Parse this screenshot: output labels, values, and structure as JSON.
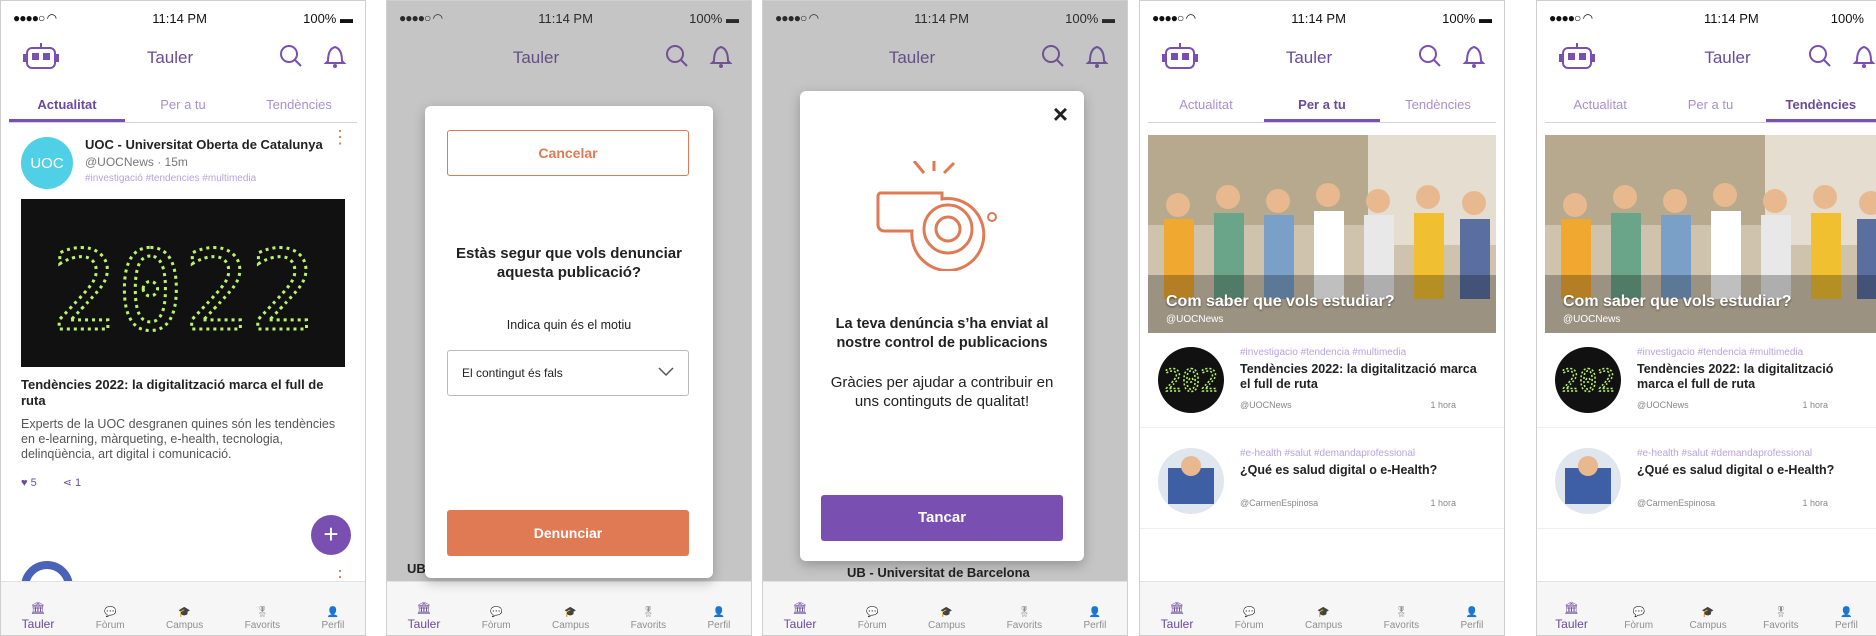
{
  "status": {
    "time": "11:14 PM",
    "battery": "100%"
  },
  "app": {
    "title": "Tauler"
  },
  "tabs": [
    "Actualitat",
    "Per a tu",
    "Tendències"
  ],
  "feed": {
    "post1": {
      "avatar_text": "UOC",
      "name": "UOC - Universitat Oberta de Catalunya",
      "handle": "@UOCNews · 15m",
      "tags": "#investigació #tendencies #multimedia",
      "image_text": "2022",
      "title": "Tendències 2022: la digitalització marca el full de ruta",
      "body": "Experts de la UOC desgranen quines són les tendències en e-learning, màrqueting, e-health, tecnologia, delinqüència, art digital i comunicació.",
      "likes": "5",
      "shares": "1"
    },
    "post2": {
      "name": "UB - Universitat de Barcelona"
    },
    "fab": "+"
  },
  "report_modal": {
    "cancel": "Cancelar",
    "question": "Estàs segur que vols denunciar aquesta publicació?",
    "reason_label": "Indica quin és el motiu",
    "reason_value": "El contingut és fals",
    "submit": "Denunciar"
  },
  "confirm_modal": {
    "close": "×",
    "title": "La teva denúncia s’ha enviat al nostre control de publicacions",
    "message": "Gràcies per ajudar a contribuir en uns continguts de qualitat!",
    "button": "Tancar"
  },
  "foryou": {
    "hero_title": "Com saber que vols estudiar?",
    "hero_author": "@UOCNews",
    "items": [
      {
        "tags": "#investigacio #tendencia #multimedia",
        "title": "Tendències 2022: la digitalització marca el full de ruta",
        "author": "@UOCNews",
        "time": "1 hora"
      },
      {
        "tags": "#e-health #salut #demandaprofessional",
        "title": "¿Qué es salud digital o e-Health?",
        "author": "@CarmenEspinosa",
        "time": "1 hora"
      }
    ]
  },
  "nav": [
    "Tauler",
    "Fòrum",
    "Campus",
    "Favorits",
    "Perfil"
  ],
  "colors": {
    "purple": "#7a4fb2",
    "orange": "#e07a54",
    "cyan": "#4fd0e7"
  }
}
